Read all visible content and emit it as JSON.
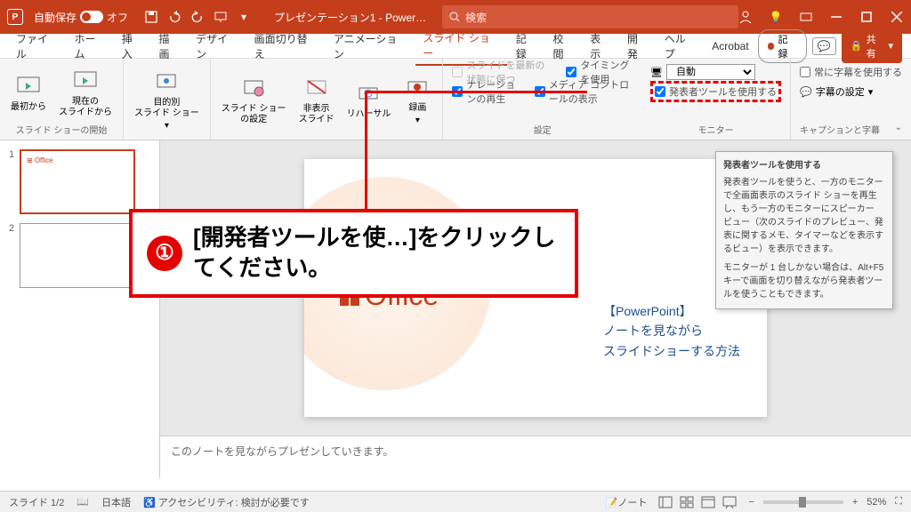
{
  "titlebar": {
    "autosave_label": "自動保存",
    "autosave_state": "オフ",
    "title": "プレゼンテーション1 - Power…",
    "search_placeholder": "検索"
  },
  "tabs": {
    "items": [
      "ファイル",
      "ホーム",
      "挿入",
      "描画",
      "デザイン",
      "画面切り替え",
      "アニメーション",
      "スライド ショー",
      "記録",
      "校閲",
      "表示",
      "開発",
      "ヘルプ",
      "Acrobat"
    ],
    "active_index": 7,
    "record": "記録",
    "share": "共有"
  },
  "ribbon": {
    "start": {
      "from_beginning": "最初から",
      "from_current": "現在の\nスライドから",
      "group": "スライド ショーの開始",
      "custom": "目的別\nスライド ショー"
    },
    "setup": {
      "setup": "スライド ショー\nの設定",
      "hide": "非表示\nスライド",
      "rehearse": "リハーサル",
      "record": "録画",
      "keep_updated": "スライドを最新の状態に保つ",
      "use_timing": "タイミングを使用",
      "narration": "ナレーションの再生",
      "media_controls": "メディア コントロールの表示",
      "group": "設定"
    },
    "monitor": {
      "monitor_icon": "📺",
      "auto": "自動",
      "presenter": "発表者ツールを使用する",
      "group": "モニター"
    },
    "captions": {
      "always": "常に字幕を使用する",
      "settings": "字幕の設定",
      "group": "キャプションと字幕"
    }
  },
  "tooltip": {
    "title": "発表者ツールを使用する",
    "body": "発表者ツールを使うと、一方のモニターで全画面表示のスライド ショーを再生し、もう一方のモニターにスピーカー ビュー（次のスライドのプレビュー、発表に関するメモ、タイマーなどを表示するビュー）を表示できます。",
    "extra": "モニターが 1 台しかない場合は、Alt+F5 キーで画面を切り替えながら発表者ツールを使うこともできます。"
  },
  "callout": {
    "num": "①",
    "text": "[開発者ツールを使…]をクリックしてください。"
  },
  "thumbs": {
    "items": [
      {
        "num": "1",
        "label": "Office"
      },
      {
        "num": "2",
        "label": ""
      }
    ]
  },
  "slide": {
    "office": "Office",
    "pp": "【PowerPoint】",
    "l1": "ノートを見ながら",
    "l2": "スライドショーする方法"
  },
  "notes": {
    "text": "このノートを見ながらプレゼンしていきます。"
  },
  "statusbar": {
    "slide": "スライド 1/2",
    "lang": "日本語",
    "access": "アクセシビリティ: 検討が必要です",
    "notes": "ノート",
    "zoom": "52%"
  }
}
